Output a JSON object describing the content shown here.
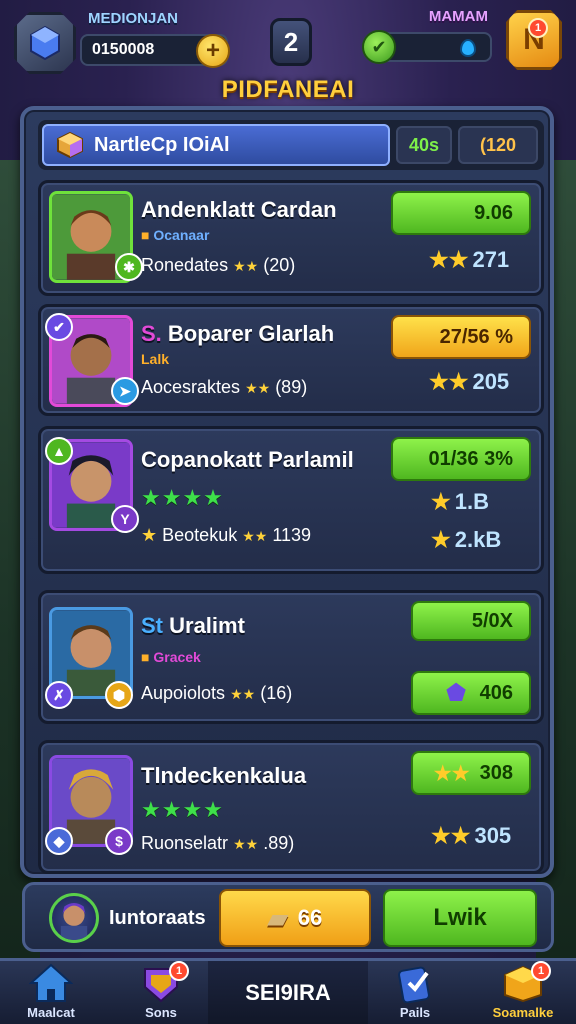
{
  "header": {
    "left_name": "MEDIONJAN",
    "currency_value": "0150008",
    "level": "2",
    "right_name": "MAMAM",
    "corner_notif": "1"
  },
  "title": "PIDFANEAI",
  "section": {
    "tab_label": "NartleCp IOiAl",
    "box_a": "40s",
    "box_b": "(120"
  },
  "rows": [
    {
      "name": "Andenklatt Cardan",
      "sub": "Ocanaar",
      "meta": "Ronedates",
      "meta_count": "(20)",
      "pill": "9.06",
      "stat": "271"
    },
    {
      "name": "Boparer Glarlah",
      "tag": "S.",
      "sub": "Lalk",
      "meta": "Aocesraktes",
      "meta_count": "(89)",
      "pill": "27/56 %",
      "stat": "205"
    },
    {
      "name": "Copanokatt Parlamil",
      "meta": "Beotekuk",
      "meta_count": "1139",
      "pill": "01/36 3%",
      "stat1": "1.B",
      "stat2": "2.kB"
    },
    {
      "name": "Uralimt",
      "tag": "St",
      "sub": "Gracek",
      "meta": "Aupoiolots",
      "meta_count": "(16)",
      "pill": "5/0X",
      "pill2": "406"
    },
    {
      "name": "Tlndeckenkalua",
      "meta": "Ruonselatr",
      "meta_count": ".89)",
      "pill": "308",
      "stat": "305"
    }
  ],
  "actionbar": {
    "label": "Iuntoraats",
    "gold_value": "66",
    "green_label": "Lwik"
  },
  "nav": [
    {
      "label": "Maalcat",
      "icon": "house-icon",
      "badge": ""
    },
    {
      "label": "Sons",
      "icon": "shield-icon",
      "badge": "1"
    },
    {
      "label": "SEI9IRA",
      "icon": "",
      "badge": ""
    },
    {
      "label": "Pails",
      "icon": "card-icon",
      "badge": ""
    },
    {
      "label": "Soamalke",
      "icon": "chest-icon",
      "badge": "1"
    }
  ],
  "colors": {
    "accent_gold": "#ffcf3d",
    "accent_green": "#6fe23b",
    "panel_bg": "#2c3b5e"
  }
}
